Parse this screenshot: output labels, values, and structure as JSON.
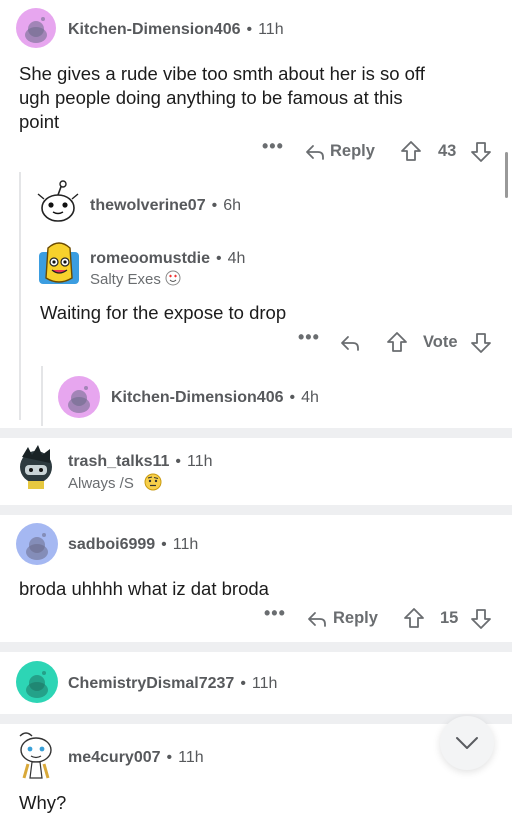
{
  "comments": [
    {
      "username": "Kitchen-Dimension406",
      "time": "11h",
      "body_lines": [
        "She gives a rude vibe too smth about her is so off",
        "ugh  people doing anything to be famous at this",
        "point"
      ],
      "reply_label": "Reply",
      "votes": "43"
    },
    {
      "username": "thewolverine07",
      "time": "6h"
    },
    {
      "username": "romeoomustdie",
      "time": "4h",
      "flair": "Salty Exes",
      "body": "Waiting for the expose to drop",
      "vote_label": "Vote"
    },
    {
      "username": "Kitchen-Dimension406",
      "time": "4h"
    },
    {
      "username": "trash_talks11",
      "time": "11h",
      "flair": "Always /S"
    },
    {
      "username": "sadboi6999",
      "time": "11h",
      "body": "broda  uhhhh what iz dat broda",
      "reply_label": "Reply",
      "votes": "15"
    },
    {
      "username": "ChemistryDismal7237",
      "time": "11h"
    },
    {
      "username": "me4cury007",
      "time": "11h",
      "body": "Why?"
    }
  ],
  "dot_separator": "•",
  "more_dots": "•••",
  "colors": {
    "avatar_pink": "#e7a6ef",
    "avatar_blue": "#a5b8f2",
    "avatar_teal": "#2dd5b5",
    "separator": "#eeeff1"
  }
}
